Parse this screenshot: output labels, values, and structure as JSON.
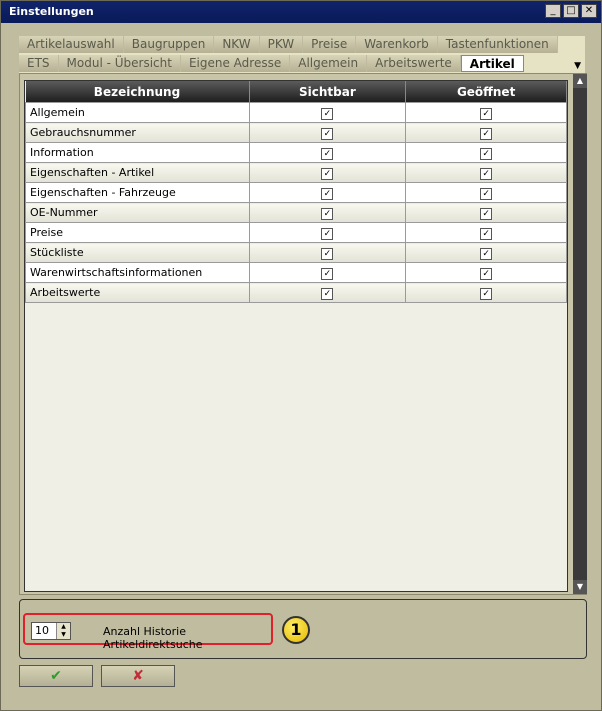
{
  "window": {
    "title": "Einstellungen"
  },
  "tabs_row1": [
    "Artikelauswahl",
    "Baugruppen",
    "NKW",
    "PKW",
    "Preise",
    "Warenkorb",
    "Tastenfunktionen"
  ],
  "tabs_row2": [
    "ETS",
    "Modul - Übersicht",
    "Eigene Adresse",
    "Allgemein",
    "Arbeitswerte",
    "Artikel"
  ],
  "active_tab": "Artikel",
  "table": {
    "columns": [
      "Bezeichnung",
      "Sichtbar",
      "Geöffnet"
    ],
    "rows": [
      {
        "name": "Allgemein",
        "sichtbar": true,
        "geoeffnet": true
      },
      {
        "name": "Gebrauchsnummer",
        "sichtbar": true,
        "geoeffnet": true
      },
      {
        "name": "Information",
        "sichtbar": true,
        "geoeffnet": true
      },
      {
        "name": "Eigenschaften - Artikel",
        "sichtbar": true,
        "geoeffnet": true
      },
      {
        "name": "Eigenschaften - Fahrzeuge",
        "sichtbar": true,
        "geoeffnet": true
      },
      {
        "name": "OE-Nummer",
        "sichtbar": true,
        "geoeffnet": true
      },
      {
        "name": "Preise",
        "sichtbar": true,
        "geoeffnet": true
      },
      {
        "name": "Stückliste",
        "sichtbar": true,
        "geoeffnet": true
      },
      {
        "name": "Warenwirtschaftsinformationen",
        "sichtbar": true,
        "geoeffnet": true
      },
      {
        "name": "Arbeitswerte",
        "sichtbar": true,
        "geoeffnet": true
      }
    ]
  },
  "history": {
    "value": "10",
    "label": "Anzahl Historie Artikeldirektsuche"
  },
  "icons": {
    "info": "info-icon",
    "ok": "checkmark-icon",
    "cancel": "cross-icon"
  },
  "colors": {
    "titlebar": "#10246a",
    "highlight": "#e0202a",
    "info": "#e5b800",
    "ok": "#2aa02a",
    "cancel": "#c42a3a"
  }
}
